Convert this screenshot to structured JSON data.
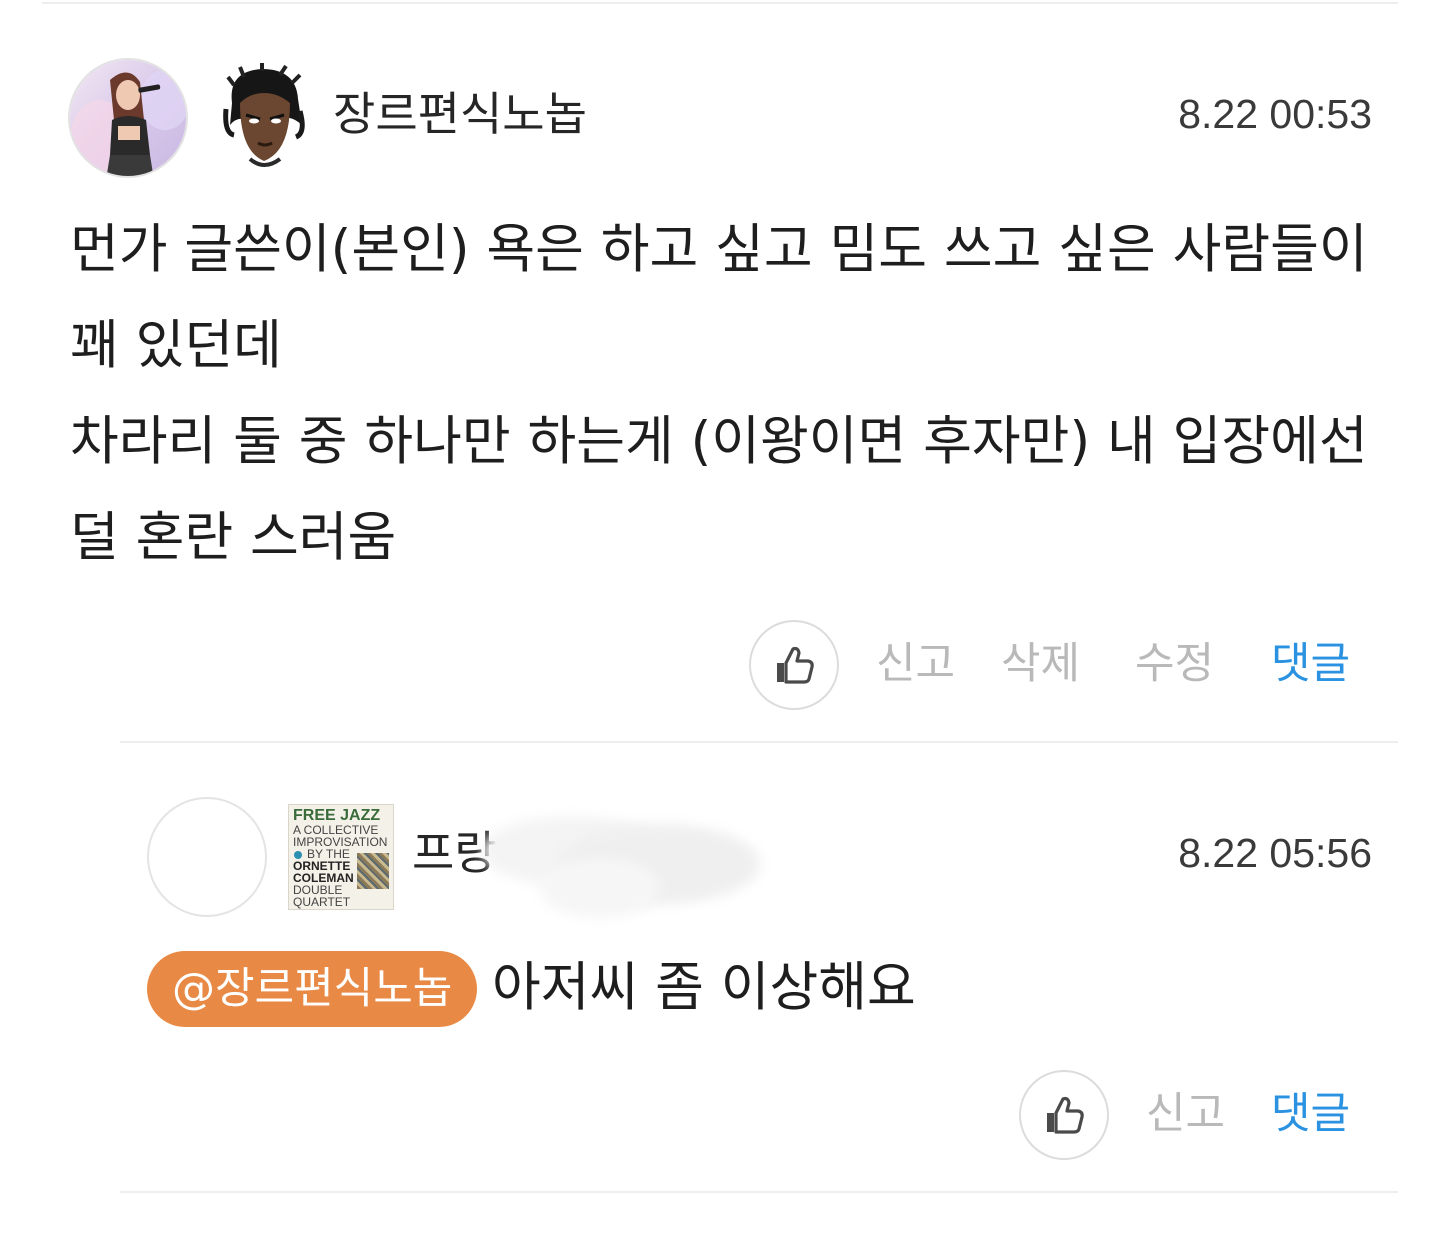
{
  "comment": {
    "nickname": "장르편식노놉",
    "timestamp": "8.22 00:53",
    "body_lines": [
      "먼가 글쓴이(본인) 욕은 하고 싶고 밈도 쓰고 싶은 사람들이",
      "꽤 있던데",
      "차라리 둘 중 하나만 하는게 (이왕이면 후자만) 내 입장에선",
      "덜 혼란 스러움"
    ],
    "actions": {
      "report": "신고",
      "delete": "삭제",
      "edit": "수정",
      "reply": "댓글"
    }
  },
  "reply": {
    "nickname_visible": "프랑",
    "timestamp": "8.22 05:56",
    "mention": "@장르편식노놉",
    "text": "아저씨 좀 이상해요",
    "badge": {
      "line1": "FREE JAZZ",
      "line2": "A COLLECTIVE",
      "line3": "IMPROVISATION",
      "line4": "BY THE",
      "line5": "ORNETTE",
      "line6": "COLEMAN",
      "line7": "DOUBLE",
      "line8": "QUARTET"
    },
    "actions": {
      "report": "신고",
      "reply": "댓글"
    }
  },
  "colors": {
    "reply_action": "#2a92e0",
    "mention_bg": "#e88a45",
    "muted_action": "#b9b9b9"
  }
}
